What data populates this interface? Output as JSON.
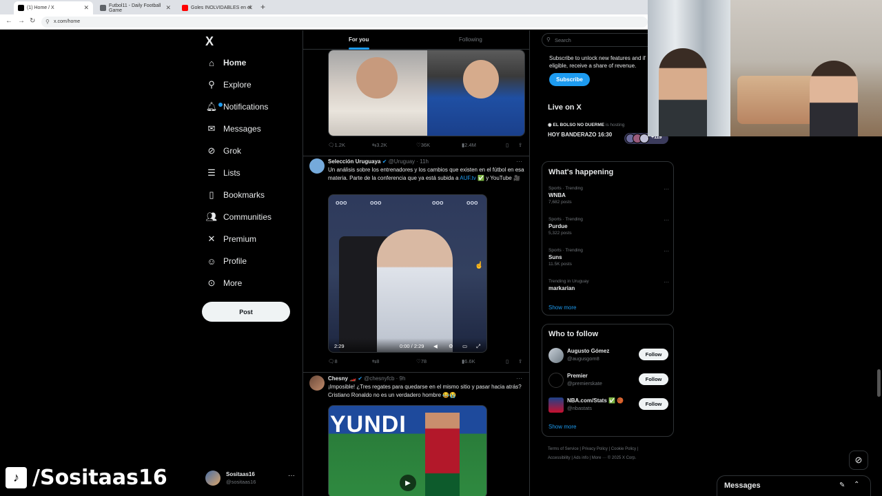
{
  "browser": {
    "tabs": [
      {
        "label": "(1) Home / X",
        "color": "#000000"
      },
      {
        "label": "Futbol11 - Daily Football Game",
        "color": "#5f6368"
      },
      {
        "label": "Goles INOLVIDABLES en el",
        "color": "#ff0000"
      }
    ],
    "url": "x.com/home",
    "nav": {
      "back": "←",
      "forward": "→",
      "reload": "↻"
    }
  },
  "sidebar": {
    "logo": "X",
    "items": [
      {
        "label": "Home",
        "icon": "home-icon"
      },
      {
        "label": "Explore",
        "icon": "search-icon"
      },
      {
        "label": "Notifications",
        "icon": "bell-icon"
      },
      {
        "label": "Messages",
        "icon": "mail-icon"
      },
      {
        "label": "Grok",
        "icon": "grok-icon"
      },
      {
        "label": "Lists",
        "icon": "list-icon"
      },
      {
        "label": "Bookmarks",
        "icon": "bookmark-icon"
      },
      {
        "label": "Communities",
        "icon": "people-icon"
      },
      {
        "label": "Premium",
        "icon": "x-icon"
      },
      {
        "label": "Profile",
        "icon": "person-icon"
      },
      {
        "label": "More",
        "icon": "more-circle-icon"
      }
    ],
    "post_label": "Post",
    "account": {
      "name": "Sositaas16",
      "handle": "@sositaas16"
    }
  },
  "feed": {
    "tabs": {
      "for_you": "For you",
      "following": "Following"
    },
    "tweet1": {
      "replies": "1.2K",
      "retweets": "3.2K",
      "likes": "36K",
      "views": "2.4M"
    },
    "tweet2": {
      "name": "Selección Uruguaya",
      "handle": "@Uruguay",
      "time": "· 11h",
      "text_before": "Un análisis sobre los entrenadores y los cambios que existen en el fútbol en esa materia. Parte de la conferencia que ya está subida a ",
      "link": "AUF.tv",
      "text_after": " ✅ y YouTube 🎥",
      "video_duration": "2:29",
      "video_time": "0:00 / 2:29",
      "replies": "8",
      "retweets": "8",
      "likes": "78",
      "views": "6.6K"
    },
    "tweet3": {
      "name": "Chesny 🏎️",
      "handle": "@chesnyfcb",
      "time": "· 9h",
      "text": "¡Imposible! ¿Tres regates para quedarse en el mismo sitio y pasar hacia atrás? Cristiano Ronaldo no es un verdadero hombre 😂😭",
      "ad_text": "YUNDI"
    }
  },
  "right": {
    "search_placeholder": "Search",
    "subscribe_text": "Subscribe to unlock new features and if eligible, receive a share of revenue.",
    "subscribe_label": "Subscribe",
    "live": {
      "title": "Live on X",
      "host": "EL BOLSO NO DUERME",
      "host_suffix": " is hosting",
      "name": "HOY BANDERAZO 16:30",
      "count": "+119"
    },
    "happening_title": "What's happening",
    "trends": [
      {
        "category": "Sports · Trending",
        "name": "WNBA",
        "count": "7,682 posts"
      },
      {
        "category": "Sports · Trending",
        "name": "Purdue",
        "count": "5,322 posts"
      },
      {
        "category": "Sports · Trending",
        "name": "Suns",
        "count": "11.5K posts"
      },
      {
        "category": "Trending in Uruguay",
        "name": "markarian",
        "count": ""
      }
    ],
    "show_more": "Show more",
    "who_title": "Who to follow",
    "follow": [
      {
        "name": "Augusto Gómez",
        "handle": "@augusgom8",
        "button": "Follow"
      },
      {
        "name": "Premier",
        "handle": "@premierskate",
        "button": "Follow"
      },
      {
        "name": "NBA.com/Stats ✅ 🏀",
        "handle": "@nbastats",
        "button": "Follow"
      }
    ],
    "footer_line1": "Terms of Service  |  Privacy Policy  |  Cookie Policy  |",
    "footer_line2": "Accessibility  |  Ads info  |  More ···  © 2025 X Corp."
  },
  "overlay": {
    "watermark": "/Sositaas16",
    "messages_label": "Messages"
  }
}
